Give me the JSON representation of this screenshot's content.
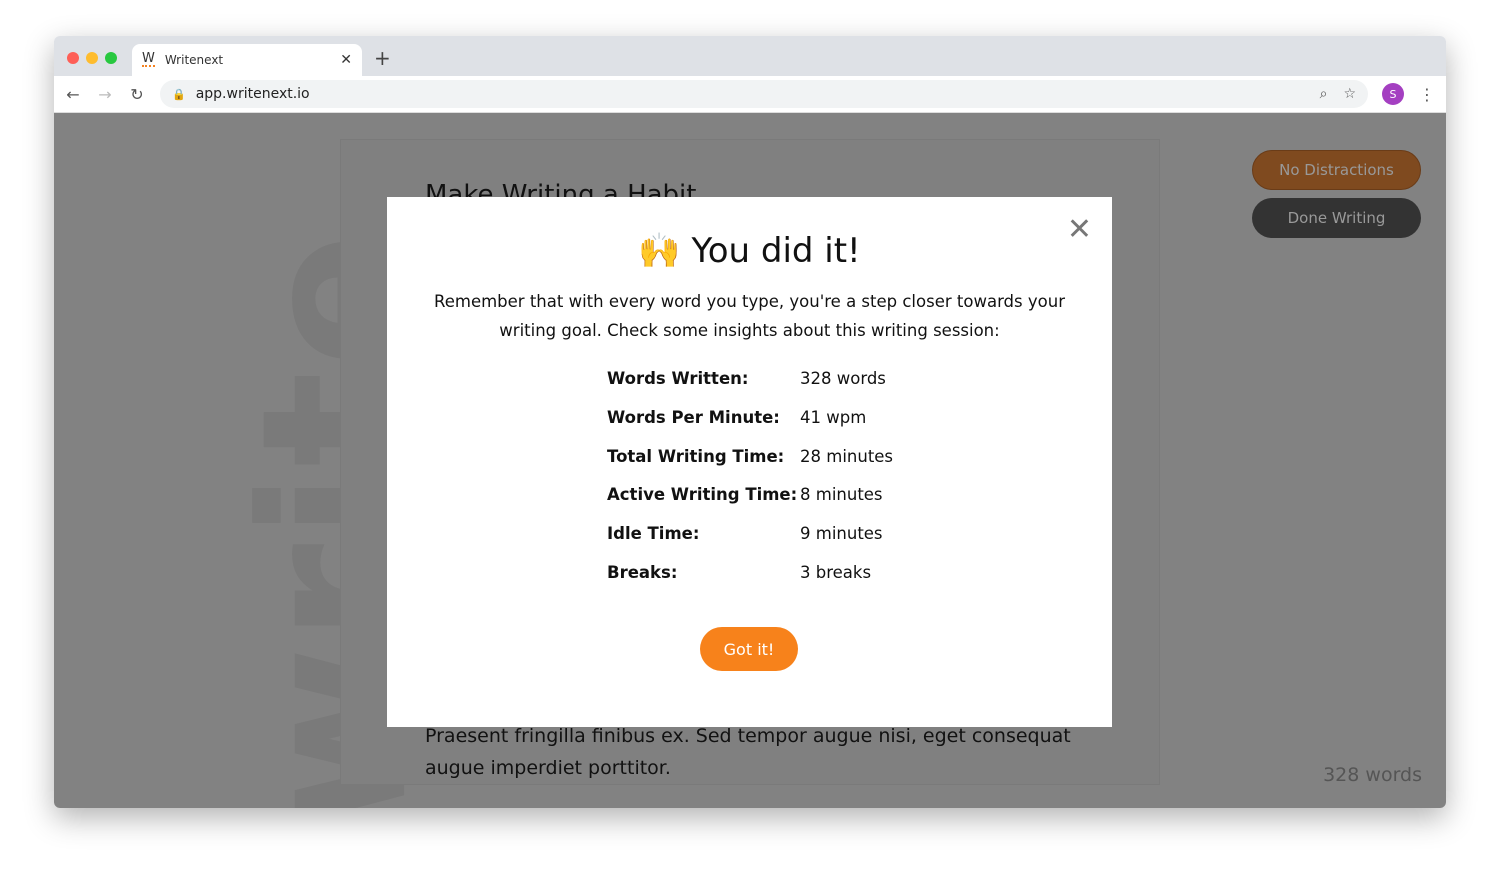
{
  "browser": {
    "tab_title": "Writenext",
    "favicon": "W",
    "url": "app.writenext.io"
  },
  "colors": {
    "accent": "#f7821b",
    "overlay": "#808080",
    "avatar": "#a43fc1"
  },
  "page": {
    "watermark": "write",
    "doc_title": "Make Writing a Habit",
    "doc_text": "Praesent fringilla finibus ex. Sed tempor augue nisi, eget consequat augue imperdiet porttitor.",
    "no_distractions": "No Distractions",
    "done_writing": "Done Writing",
    "word_count": "328 words"
  },
  "modal": {
    "emoji": "🙌",
    "title": "You did it!",
    "description": "Remember that with every word you type, you're a step closer towards your writing goal. Check some insights about this writing session:",
    "stats": [
      {
        "label": "Words Written:",
        "value": "328 words"
      },
      {
        "label": "Words Per Minute:",
        "value": "41 wpm"
      },
      {
        "label": "Total Writing Time:",
        "value": "28 minutes"
      },
      {
        "label": "Active Writing Time:",
        "value": "8 minutes"
      },
      {
        "label": "Idle Time:",
        "value": "9 minutes"
      },
      {
        "label": "Breaks:",
        "value": "3 breaks"
      }
    ],
    "button": "Got it!"
  },
  "profile": {
    "initial": "S"
  }
}
